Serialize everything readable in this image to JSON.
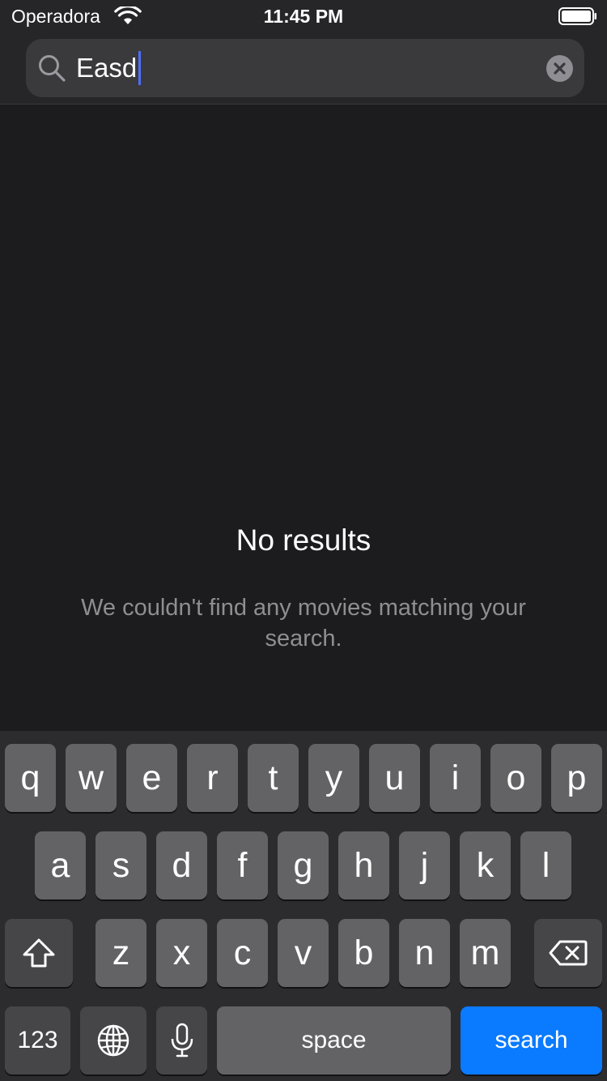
{
  "status_bar": {
    "carrier": "Operadora",
    "time": "11:45 PM"
  },
  "search": {
    "value": "Easd"
  },
  "empty_state": {
    "title": "No results",
    "message": "We couldn't find any movies matching your search."
  },
  "keyboard": {
    "row1": [
      "q",
      "w",
      "e",
      "r",
      "t",
      "y",
      "u",
      "i",
      "o",
      "p"
    ],
    "row2": [
      "a",
      "s",
      "d",
      "f",
      "g",
      "h",
      "j",
      "k",
      "l"
    ],
    "row3": [
      "z",
      "x",
      "c",
      "v",
      "b",
      "n",
      "m"
    ],
    "numbers_label": "123",
    "space_label": "space",
    "search_label": "search"
  },
  "colors": {
    "background": "#1c1c1e",
    "caret": "#4d6ff9",
    "search_key": "#0a7aff"
  }
}
